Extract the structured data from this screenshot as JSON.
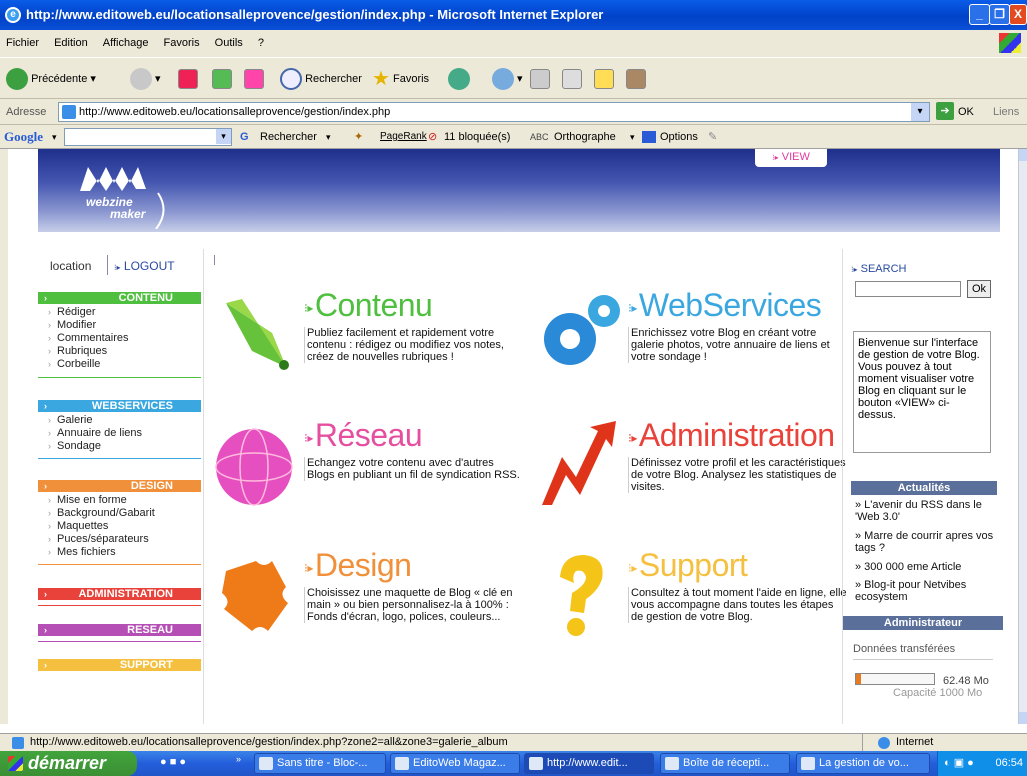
{
  "window": {
    "title": "http://www.editoweb.eu/locationsalleprovence/gestion/index.php - Microsoft Internet Explorer"
  },
  "menu": [
    "Fichier",
    "Edition",
    "Affichage",
    "Favoris",
    "Outils",
    "?"
  ],
  "toolbar": {
    "back": "Précédente",
    "search": "Rechercher",
    "favorites": "Favoris"
  },
  "address": {
    "label": "Adresse",
    "url": "http://www.editoweb.eu/locationsalleprovence/gestion/index.php",
    "go": "OK",
    "links": "Liens"
  },
  "googlebar": {
    "logo": "Google",
    "search": "Rechercher",
    "pagerank": "PageRank",
    "blocked": "11 bloquée(s)",
    "spell": "Orthographe",
    "options": "Options"
  },
  "banner": {
    "logo_line1": "webzine",
    "logo_line2": "maker",
    "view": "VIEW"
  },
  "leftnav": {
    "location": "location",
    "logout": "LOGOUT",
    "contenu": {
      "title": "CONTENU",
      "items": [
        "Rédiger",
        "Modifier",
        "Commentaires",
        "Rubriques",
        "Corbeille"
      ]
    },
    "webservices": {
      "title": "WEBSERVICES",
      "items": [
        "Galerie",
        "Annuaire de liens",
        "Sondage"
      ]
    },
    "design": {
      "title": "DESIGN",
      "items": [
        "Mise en forme",
        "Background/Gabarit",
        "Maquettes",
        "Puces/séparateurs",
        "Mes fichiers"
      ]
    },
    "administration": {
      "title": "ADMINISTRATION"
    },
    "reseau": {
      "title": "RESEAU"
    },
    "support": {
      "title": "SUPPORT"
    }
  },
  "main": {
    "contenu": {
      "title": "Contenu",
      "desc": "Publiez facilement et rapidement votre contenu : rédigez ou modifiez vos notes, créez de nouvelles rubriques !"
    },
    "webservices": {
      "title": "WebServices",
      "desc": "Enrichissez votre Blog en créant votre galerie photos, votre annuaire de liens et votre sondage !"
    },
    "reseau": {
      "title": "Réseau",
      "desc": "Echangez votre contenu avec d'autres Blogs en publiant un fil de syndication RSS."
    },
    "administration": {
      "title": "Administration",
      "desc": "Définissez votre profil et les caractéristiques de votre Blog. Analysez les statistiques de visites."
    },
    "design": {
      "title": "Design",
      "desc": "Choisissez une maquette de Blog « clé en main » ou bien personnalisez-la à 100% : Fonds d'écran, logo, polices, couleurs..."
    },
    "support": {
      "title": "Support",
      "desc": "Consultez à tout moment l'aide en ligne, elle vous accompagne dans toutes les étapes de gestion de votre Blog."
    }
  },
  "right": {
    "search_label": "SEARCH",
    "search_button": "Ok",
    "welcome": "Bienvenue sur l'interface de gestion de votre Blog. Vous pouvez à tout moment visualiser votre Blog en cliquant sur le bouton «VIEW» ci-dessus.",
    "actualites_title": "Actualités",
    "actualites": [
      "» L'avenir du RSS dans le 'Web 3.0'",
      "» Marre de courrir apres vos tags ?",
      "» 300 000 eme Article",
      "» Blog-it pour Netvibes ecosystem"
    ],
    "admin_title": "Administrateur",
    "data_label": "Données transférées",
    "data_used": "62.48 Mo",
    "data_capacity": "Capacité 1000 Mo",
    "usage_fraction": 0.06
  },
  "status": {
    "url": "http://www.editoweb.eu/locationsalleprovence/gestion/index.php?zone2=all&zone3=galerie_album",
    "zone": "Internet"
  },
  "taskbar": {
    "start": "démarrer",
    "tasks": [
      "Sans titre - Bloc-...",
      "EditoWeb Magaz...",
      "http://www.edit...",
      "Boîte de récepti...",
      "La gestion de vo..."
    ],
    "clock": "06:54"
  },
  "colors": {
    "contenu": "#4fbf3f",
    "webservices": "#3aa7e0",
    "design": "#f0903a",
    "administration": "#e8423a",
    "reseau": "#b54fb5",
    "support": "#f5c040"
  }
}
